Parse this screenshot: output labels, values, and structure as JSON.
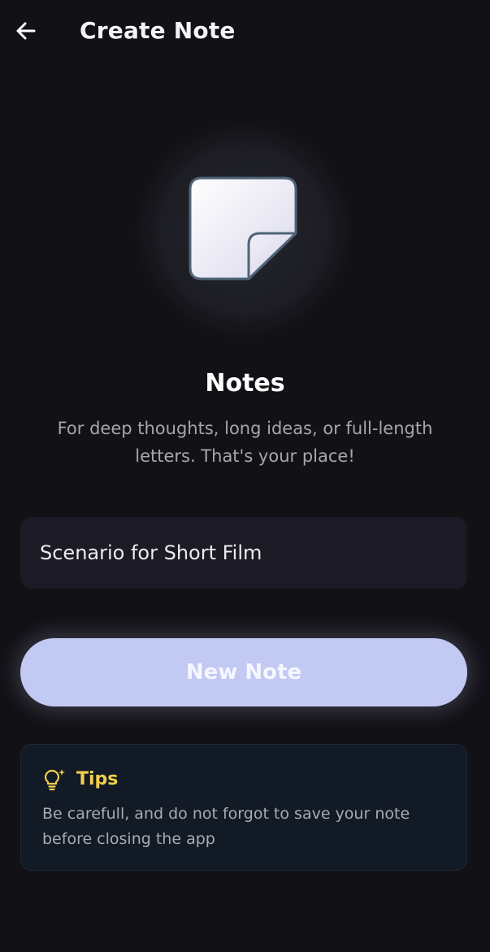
{
  "header": {
    "title": "Create Note",
    "back_icon": "arrow-left-icon"
  },
  "hero": {
    "icon": "note-icon",
    "title": "Notes",
    "description": "For deep thoughts, long ideas, or full-length letters. That's your place!"
  },
  "form": {
    "note_title_value": "Scenario for Short Film",
    "new_note_label": "New Note"
  },
  "tips": {
    "icon": "lightbulb-icon",
    "title": "Tips",
    "text": "Be carefull, and do not forgot to save your note before closing the app"
  },
  "colors": {
    "background": "#121116",
    "accent": "#c2c9f2",
    "tips_title": "#f2cf4d",
    "input_bg": "#1c1b25"
  }
}
